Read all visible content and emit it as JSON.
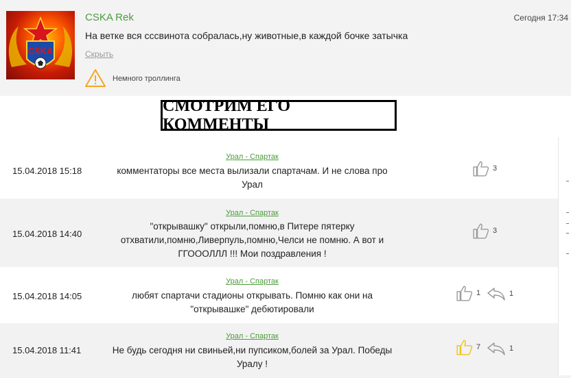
{
  "comment": {
    "author": "CSKA Rek",
    "time": "Сегодня 17:34",
    "text": "На ветке вся сссвинота собралась,ну животные,в каждой бочке затычка",
    "hide_label": "Скрыть",
    "warning_label": "Немного троллинга"
  },
  "banner": {
    "text": "СМОТРИМ ЕГО КОММЕНТЫ"
  },
  "rows": [
    {
      "date": "15.04.2018 15:18",
      "match": "Урал - Спартак",
      "text": "комментаторы все места вылизали спартачам. И не слова про Урал",
      "likes": "3",
      "replies": null
    },
    {
      "date": "15.04.2018 14:40",
      "match": "Урал - Спартак",
      "text": "\"открывашку\" открыли,помню,в Питере пятерку отхватили,помню,Ливерпуль,помню,Челси не помню. А вот и ГГОООЛЛЛ !!! Мои поздравления !",
      "likes": "3",
      "replies": null
    },
    {
      "date": "15.04.2018 14:05",
      "match": "Урал - Спартак",
      "text": "любят спартачи стадионы открывать. Помню как они на \"открывашке\" дебютировали",
      "likes": "1",
      "replies": "1"
    },
    {
      "date": "15.04.2018 11:41",
      "match": "Урал - Спартак",
      "text": "Не будь сегодня ни свиньей,ни пупсиком,болей за Урал. Победы Уралу !",
      "likes": "7",
      "replies": "1"
    }
  ],
  "icons": {
    "like": "thumbs-up-icon",
    "reply": "reply-arrow-icon",
    "warning": "warning-triangle-icon"
  },
  "colors": {
    "accent_green": "#4c9b3c",
    "like_grey": "#9a9a9a",
    "like_active": "#f0c419",
    "warning": "#f5a623"
  }
}
